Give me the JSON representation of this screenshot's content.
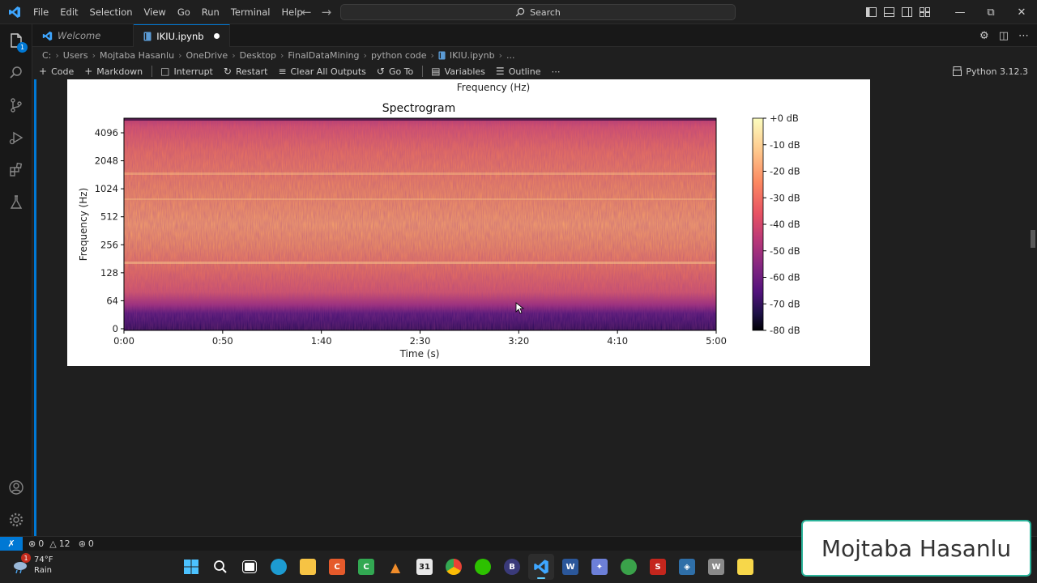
{
  "menu": [
    "File",
    "Edit",
    "Selection",
    "View",
    "Go",
    "Run",
    "Terminal",
    "Help"
  ],
  "search": {
    "label": "Search"
  },
  "tabs": [
    {
      "label": "Welcome"
    },
    {
      "label": "IKIU.ipynb"
    }
  ],
  "breadcrumb": [
    "C:",
    "Users",
    "Mojtaba Hasanlu",
    "OneDrive",
    "Desktop",
    "FinalDataMining",
    "python code",
    "IKIU.ipynb",
    "..."
  ],
  "toolbar": {
    "code": "Code",
    "markdown": "Markdown",
    "interrupt": "Interrupt",
    "restart": "Restart",
    "clear": "Clear All Outputs",
    "goto": "Go To",
    "variables": "Variables",
    "outline": "Outline",
    "more": "⋯",
    "kernel": "Python 3.12.3"
  },
  "activity": {
    "explorer_badge": "1"
  },
  "status": {
    "errors": "0",
    "warnings": "12",
    "ports": "0"
  },
  "weather": {
    "temp": "74°F",
    "cond": "Rain",
    "badge": "1"
  },
  "watermark": "Mojtaba Hasanlu",
  "colors": {
    "accent": "#0078d4",
    "watermark_border": "#2bb39a"
  },
  "chart_data": {
    "type": "heatmap",
    "prev_label": "Frequency (Hz)",
    "title": "Spectrogram",
    "xlabel": "Time (s)",
    "ylabel": "Frequency (Hz)",
    "xticks": [
      "0:00",
      "0:50",
      "1:40",
      "2:30",
      "3:20",
      "4:10",
      "5:00"
    ],
    "yticks": [
      "0",
      "64",
      "128",
      "256",
      "512",
      "1024",
      "2048",
      "4096"
    ],
    "colorbar_ticks": [
      "+0 dB",
      "-10 dB",
      "-20 dB",
      "-30 dB",
      "-40 dB",
      "-50 dB",
      "-60 dB",
      "-70 dB",
      "-80 dB"
    ],
    "colormap": "magma",
    "yscale": "log",
    "xlim": [
      0,
      300
    ],
    "clim": [
      -80,
      0
    ]
  }
}
